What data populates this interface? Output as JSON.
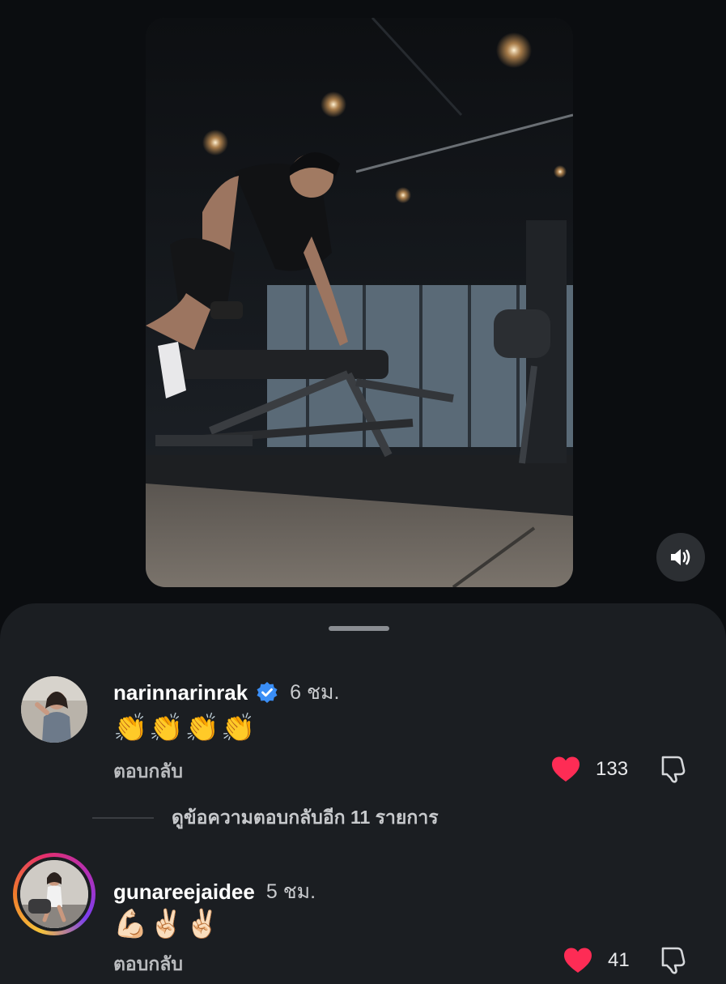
{
  "video": {
    "sound_icon": "speaker-icon"
  },
  "comments": [
    {
      "username": "narinnarinrak",
      "verified": true,
      "time": "6 ชม.",
      "text": "👏👏👏👏",
      "reply_label": "ตอบกลับ",
      "likes": "133",
      "liked": true
    },
    {
      "username": "gunareejaidee",
      "verified": false,
      "time": "5 ชม.",
      "text": "💪🏻✌🏻✌🏻",
      "reply_label": "ตอบกลับ",
      "likes": "41",
      "liked": true
    }
  ],
  "more_replies": {
    "label": "ดูข้อความตอบกลับอีก 11 รายการ"
  },
  "colors": {
    "like": "#fe2c55",
    "verified": "#3a8ef6",
    "sheet": "#1b1e22"
  }
}
